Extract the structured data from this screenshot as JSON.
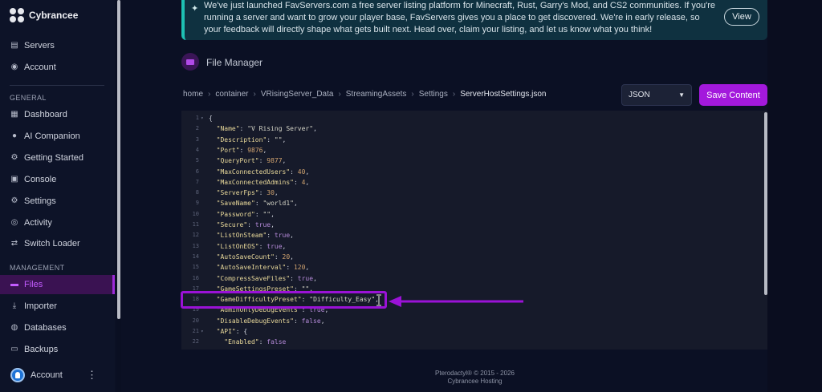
{
  "brand": {
    "name": "Cybrancee"
  },
  "sidebar": {
    "top_items": [
      {
        "label": "Servers",
        "icon": "server-icon"
      },
      {
        "label": "Account",
        "icon": "account-icon"
      }
    ],
    "general_label": "GENERAL",
    "general_items": [
      {
        "label": "Dashboard",
        "icon": "grid-icon"
      },
      {
        "label": "AI Companion",
        "icon": "chat-icon"
      },
      {
        "label": "Getting Started",
        "icon": "gear-icon"
      },
      {
        "label": "Console",
        "icon": "terminal-icon"
      },
      {
        "label": "Settings",
        "icon": "gear-icon"
      },
      {
        "label": "Activity",
        "icon": "eye-icon"
      },
      {
        "label": "Switch Loader",
        "icon": "swap-icon"
      }
    ],
    "management_label": "MANAGEMENT",
    "management_items": [
      {
        "label": "Files",
        "icon": "folder-icon",
        "active": true
      },
      {
        "label": "Importer",
        "icon": "download-icon"
      },
      {
        "label": "Databases",
        "icon": "database-icon"
      },
      {
        "label": "Backups",
        "icon": "archive-icon"
      }
    ],
    "account_bottom": "Account"
  },
  "banner": {
    "text": "We've just launched FavServers.com a free server listing platform for Minecraft, Rust, Garry's Mod, and CS2 communities. If you're running a server and want to grow your player base, FavServers gives you a place to get discovered. We're in early release, so your feedback will directly shape what gets built next. Head over, claim your listing, and let us know what you think!",
    "button": "View"
  },
  "page": {
    "title": "File Manager"
  },
  "breadcrumb": [
    "home",
    "container",
    "VRisingServer_Data",
    "StreamingAssets",
    "Settings",
    "ServerHostSettings.json"
  ],
  "editor": {
    "mode": "JSON",
    "save_label": "Save Content",
    "lines": [
      {
        "n": "1",
        "fold": true,
        "code": "{"
      },
      {
        "n": "2",
        "key": "\"Name\"",
        "val": "\"V Rising Server\"",
        "type": "s"
      },
      {
        "n": "3",
        "key": "\"Description\"",
        "val": "\"\"",
        "type": "s"
      },
      {
        "n": "4",
        "key": "\"Port\"",
        "val": "9876",
        "type": "n"
      },
      {
        "n": "5",
        "key": "\"QueryPort\"",
        "val": "9877",
        "type": "n"
      },
      {
        "n": "6",
        "key": "\"MaxConnectedUsers\"",
        "val": "40",
        "type": "n"
      },
      {
        "n": "7",
        "key": "\"MaxConnectedAdmins\"",
        "val": "4",
        "type": "n"
      },
      {
        "n": "8",
        "key": "\"ServerFps\"",
        "val": "30",
        "type": "n"
      },
      {
        "n": "9",
        "key": "\"SaveName\"",
        "val": "\"world1\"",
        "type": "s"
      },
      {
        "n": "10",
        "key": "\"Password\"",
        "val": "\"\"",
        "type": "s"
      },
      {
        "n": "11",
        "key": "\"Secure\"",
        "val": "true",
        "type": "b"
      },
      {
        "n": "12",
        "key": "\"ListOnSteam\"",
        "val": "true",
        "type": "b"
      },
      {
        "n": "13",
        "key": "\"ListOnEOS\"",
        "val": "true",
        "type": "b"
      },
      {
        "n": "14",
        "key": "\"AutoSaveCount\"",
        "val": "20",
        "type": "n"
      },
      {
        "n": "15",
        "key": "\"AutoSaveInterval\"",
        "val": "120",
        "type": "n"
      },
      {
        "n": "16",
        "key": "\"CompressSaveFiles\"",
        "val": "true",
        "type": "b"
      },
      {
        "n": "17",
        "key": "\"GameSettingsPreset\"",
        "val": "\"\"",
        "type": "s"
      },
      {
        "n": "18",
        "key": "\"GameDifficultyPreset\"",
        "val": "\"Difficulty_Easy\"",
        "type": "s"
      },
      {
        "n": "19",
        "key": "\"AdminOnlyDebugEvents\"",
        "val": "true",
        "type": "b"
      },
      {
        "n": "20",
        "key": "\"DisableDebugEvents\"",
        "val": "false",
        "type": "b"
      },
      {
        "n": "21",
        "fold": true,
        "key": "\"API\"",
        "val": "{",
        "type": "p"
      },
      {
        "n": "22",
        "indent": true,
        "key": "\"Enabled\"",
        "val": "false",
        "type": "b",
        "nocomma": true
      }
    ]
  },
  "footer": {
    "line1": "Pterodactyl® © 2015 - 2026",
    "line2": "Cybrancee Hosting"
  },
  "colors": {
    "accent": "#a319dc",
    "active_bg": "#3a1252",
    "banner_border": "#1ec0b3"
  }
}
